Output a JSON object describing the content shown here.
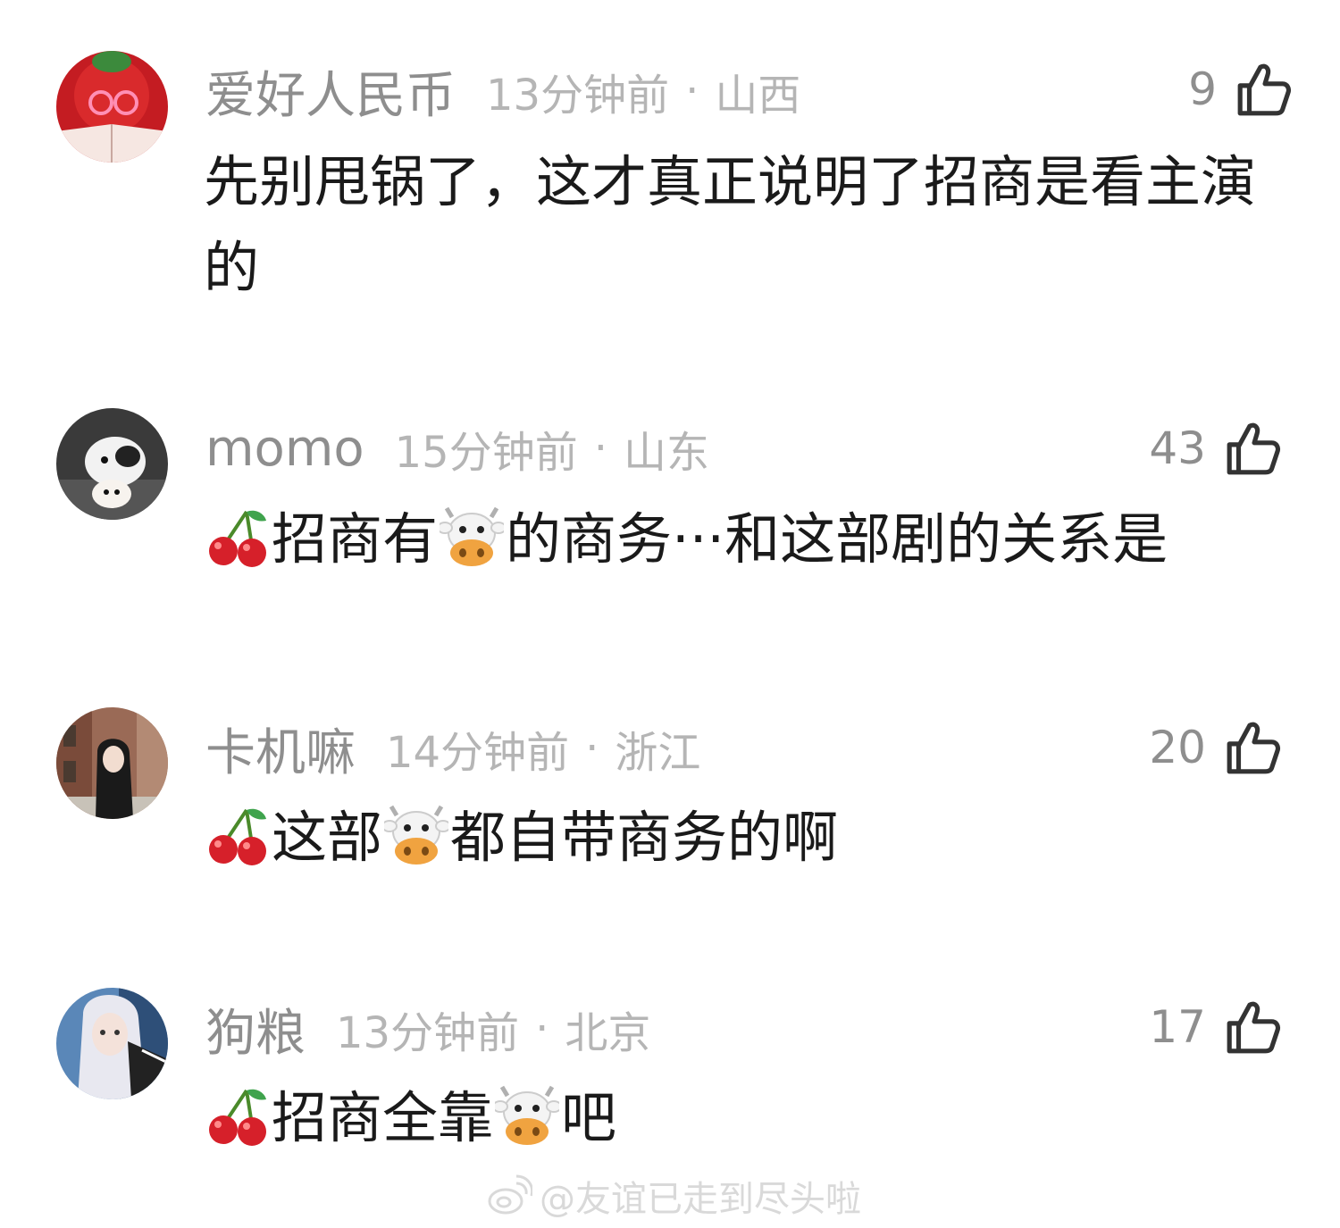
{
  "comments": [
    {
      "username": "爱好人民币",
      "time": "13分钟前",
      "separator": "·",
      "location": "山西",
      "likes": "9",
      "avatar_icon": "red-book-avatar-icon",
      "text": "先别甩锅了，这才真正说明了招商是看主演的"
    },
    {
      "username": "momo",
      "time": "15分钟前",
      "separator": "·",
      "location": "山东",
      "likes": "43",
      "avatar_icon": "puppy-avatar-icon",
      "text_parts": [
        "招商有",
        "的商务···和这部剧的关系是"
      ]
    },
    {
      "username": "卡机嘛",
      "time": "14分钟前",
      "separator": "·",
      "location": "浙江",
      "likes": "20",
      "avatar_icon": "girl-photo-avatar-icon",
      "text_parts": [
        "这部",
        "都自带商务的啊"
      ]
    },
    {
      "username": "狗粮",
      "time": "13分钟前",
      "separator": "·",
      "location": "北京",
      "likes": "17",
      "avatar_icon": "silver-hair-avatar-icon",
      "text_parts": [
        "招商全靠",
        "吧"
      ]
    }
  ],
  "emojis": {
    "cherry": "cherry-emoji-icon",
    "cow": "cow-face-emoji-icon"
  },
  "watermark": "@友谊已走到尽头啦",
  "colors": {
    "username": "#8e8e8e",
    "meta": "#b5b5b5",
    "text": "#1a1a1a",
    "cherry": "#d6202a",
    "like_icon": "#333333"
  }
}
